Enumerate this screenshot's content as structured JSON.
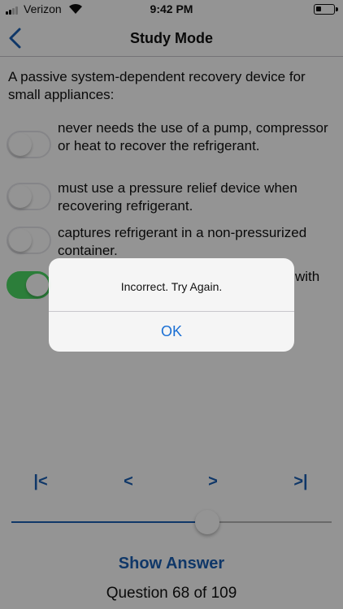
{
  "status_bar": {
    "carrier": "Verizon",
    "time": "9:42 PM",
    "icons": [
      "signal-icon",
      "wifi-icon",
      "battery-icon"
    ]
  },
  "nav": {
    "title": "Study Mode",
    "back_icon": "chevron-left-icon"
  },
  "question": {
    "text": "A passive system-dependent recovery device for small appliances:"
  },
  "options": [
    {
      "text": "never needs the use of a pump, compressor or heat to recover the refrigerant.",
      "selected": false
    },
    {
      "text": "must use a pressure relief device when recovering refrigerant.",
      "selected": false
    },
    {
      "text": "captures refrigerant in a non-pressurized container.",
      "selected": false
    },
    {
      "text": "with",
      "selected": true
    }
  ],
  "controls": {
    "first": "|<",
    "prev": "<",
    "next": ">",
    "last": ">|"
  },
  "slider": {
    "current": 68,
    "total": 109
  },
  "show_answer": "Show Answer",
  "counter": "Question 68 of 109",
  "alert": {
    "message": "Incorrect.  Try Again.",
    "ok": "OK"
  },
  "colors": {
    "accent": "#1a5fb4",
    "toggle_on": "#4cd964",
    "alert_button": "#1a6fd4"
  }
}
